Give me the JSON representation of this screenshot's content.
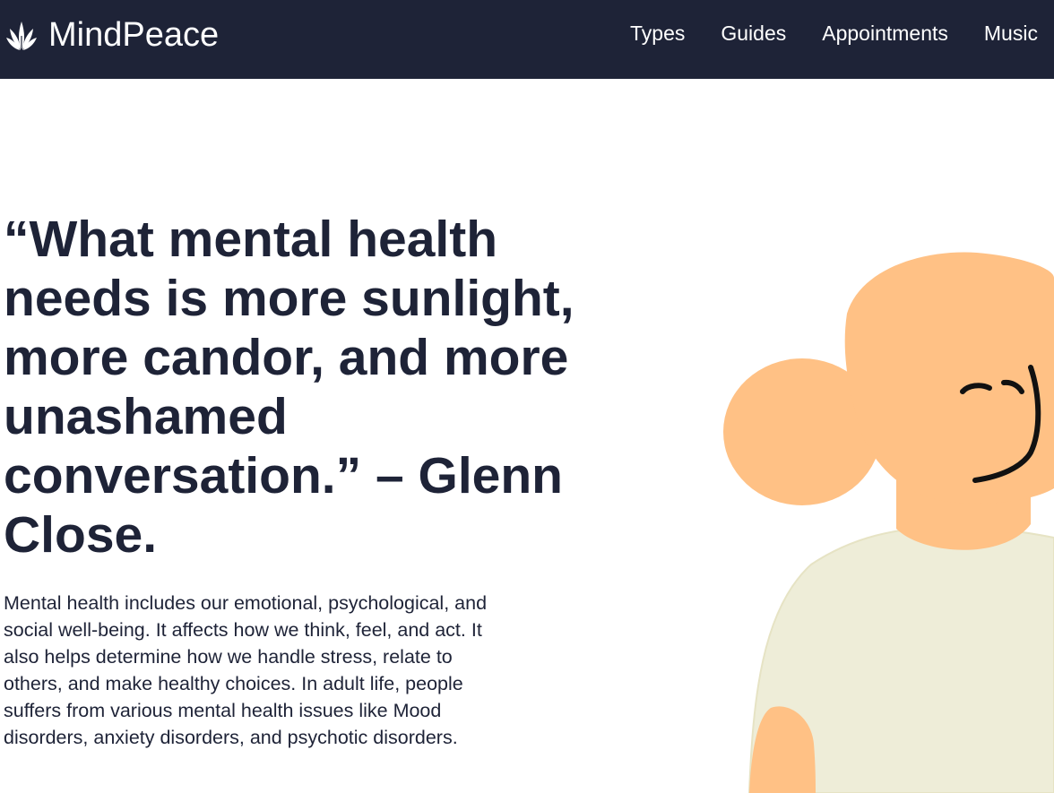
{
  "header": {
    "brand": {
      "icon": "leaf-icon",
      "name": "MindPeace"
    },
    "nav": [
      {
        "label": "Types"
      },
      {
        "label": "Guides"
      },
      {
        "label": "Appointments"
      },
      {
        "label": "Music"
      }
    ]
  },
  "hero": {
    "quote": "“What mental health needs is more sunlight, more candor, and more unashamed conversation.” – Glenn Close.",
    "description": "Mental health includes our emotional, psychological, and social well-being. It affects how we think, feel, and act. It also helps determine how we handle stress, relate to others, and make healthy choices. In adult life, people suffers from various mental health issues like Mood disorders, anxiety disorders, and psychotic disorders.",
    "illustration": "person-illustration"
  },
  "colors": {
    "navbar": "#1e2337",
    "text": "#1e2337",
    "skin": "#ffc185",
    "shirt": "#eeedd8"
  }
}
